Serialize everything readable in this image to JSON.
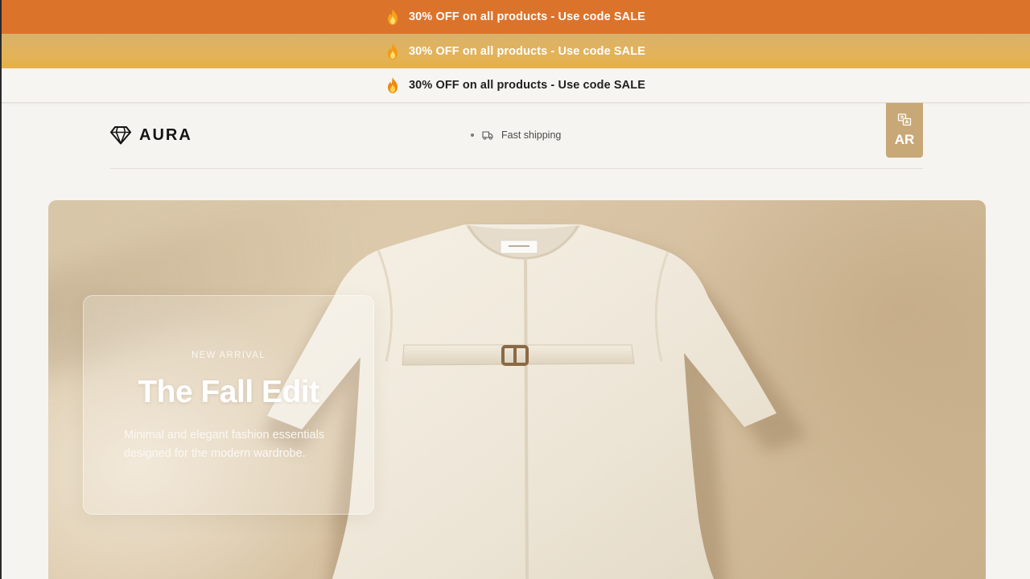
{
  "promo_bars": [
    {
      "text": "30% OFF on all products - Use code SALE"
    },
    {
      "text": "30% OFF on all products - Use code SALE"
    },
    {
      "text": "30% OFF on all products - Use code SALE"
    }
  ],
  "header": {
    "brand": "AURA",
    "feature_text": "Fast shipping",
    "language_button": "AR"
  },
  "hero": {
    "eyebrow": "NEW ARRIVAL",
    "title": "The Fall Edit",
    "description": "Minimal and elegant fashion essentials designed for the modern wardrobe."
  },
  "icons": {
    "promo": "flame-icon",
    "logo": "diamond-icon",
    "feature": "truck-icon",
    "language": "translate-icon"
  },
  "colors": {
    "promo_orange": "#dc732b",
    "promo_gold": "#e2b35a",
    "accent_tan": "#c8a877",
    "background": "#f5f4f0"
  }
}
